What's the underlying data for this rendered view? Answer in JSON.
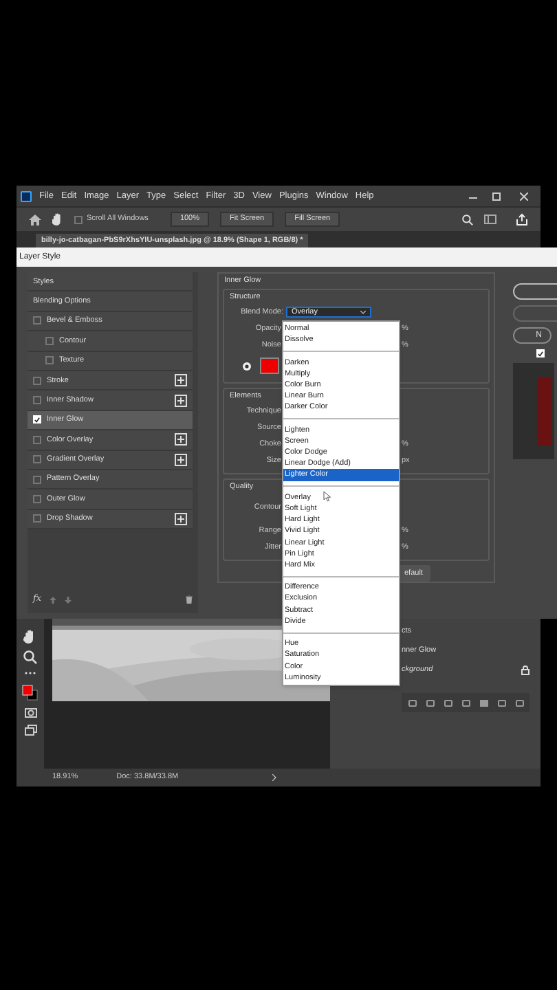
{
  "menu_bar": {
    "items": [
      "File",
      "Edit",
      "Image",
      "Layer",
      "Type",
      "Select",
      "Filter",
      "3D",
      "View",
      "Plugins",
      "Window",
      "Help"
    ]
  },
  "options_bar": {
    "scroll_all_windows": {
      "label": "Scroll All Windows",
      "checked": false
    },
    "zoom": "100%",
    "buttons": [
      "Fit Screen",
      "Fill Screen"
    ]
  },
  "document_tab": {
    "title": "billy-jo-catbagan-PbS9rXhsYIU-unsplash.jpg @ 18.9% (Shape 1, RGB/8) *"
  },
  "dialog": {
    "title": "Layer Style",
    "styles_list": [
      {
        "kind": "header",
        "label": "Styles",
        "selected": false
      },
      {
        "kind": "header",
        "label": "Blending Options",
        "selected": false
      },
      {
        "kind": "effect",
        "label": "Bevel & Emboss",
        "checked": false,
        "selected": false,
        "add_button": false,
        "children": [
          {
            "kind": "effect",
            "label": "Contour",
            "checked": false,
            "selected": false,
            "add_button": false
          },
          {
            "kind": "effect",
            "label": "Texture",
            "checked": false,
            "selected": false,
            "add_button": false
          }
        ]
      },
      {
        "kind": "effect",
        "label": "Stroke",
        "checked": false,
        "selected": false,
        "add_button": true
      },
      {
        "kind": "effect",
        "label": "Inner Shadow",
        "checked": false,
        "selected": false,
        "add_button": true
      },
      {
        "kind": "effect",
        "label": "Inner Glow",
        "checked": true,
        "selected": true,
        "add_button": false
      },
      {
        "kind": "effect",
        "label": "Color Overlay",
        "checked": false,
        "selected": false,
        "add_button": true
      },
      {
        "kind": "effect",
        "label": "Gradient Overlay",
        "checked": false,
        "selected": false,
        "add_button": true
      },
      {
        "kind": "effect",
        "label": "Pattern Overlay",
        "checked": false,
        "selected": false,
        "add_button": false
      },
      {
        "kind": "effect",
        "label": "Outer Glow",
        "checked": false,
        "selected": false,
        "add_button": false
      },
      {
        "kind": "effect",
        "label": "Drop Shadow",
        "checked": false,
        "selected": false,
        "add_button": true
      }
    ],
    "panel_title": "Inner Glow",
    "structure": {
      "title": "Structure",
      "fields": [
        {
          "label": "Blend Mode:",
          "kind": "select",
          "value": "Overlay"
        },
        {
          "label": "Opacity:",
          "kind": "unit",
          "unit": "%"
        },
        {
          "label": "Noise:",
          "kind": "unit",
          "unit": "%"
        },
        {
          "kind": "color",
          "checked": true
        }
      ]
    },
    "elements": {
      "title": "Elements",
      "fields": [
        {
          "label": "Technique:",
          "kind": "plain"
        },
        {
          "label": "Source:",
          "kind": "plain"
        },
        {
          "label": "Choke:",
          "kind": "unit",
          "unit": "%"
        },
        {
          "label": "Size:",
          "kind": "unit",
          "unit": "px"
        }
      ]
    },
    "quality": {
      "title": "Quality",
      "fields": [
        {
          "label": "Contour:",
          "kind": "tall"
        },
        {
          "label": "Range:",
          "kind": "unit",
          "unit": "%"
        },
        {
          "label": "Jitter:",
          "kind": "unit",
          "unit": "%"
        }
      ]
    },
    "default_button": "efault",
    "fx_label": "fx",
    "side_button_label": "N",
    "preview_checkbox": {
      "checked": true
    },
    "blend_mode_menu": {
      "groups": [
        [
          {
            "label": "Normal",
            "selected": false
          },
          {
            "label": "Dissolve",
            "selected": false
          }
        ],
        [
          {
            "label": "Darken",
            "selected": false
          },
          {
            "label": "Multiply",
            "selected": false
          },
          {
            "label": "Color Burn",
            "selected": false
          },
          {
            "label": "Linear Burn",
            "selected": false
          },
          {
            "label": "Darker Color",
            "selected": false
          }
        ],
        [
          {
            "label": "Lighten",
            "selected": false
          },
          {
            "label": "Screen",
            "selected": false
          },
          {
            "label": "Color Dodge",
            "selected": false
          },
          {
            "label": "Linear Dodge (Add)",
            "selected": false
          },
          {
            "label": "Lighter Color",
            "selected": true
          }
        ],
        [
          {
            "label": "Overlay",
            "selected": false
          },
          {
            "label": "Soft Light",
            "selected": false
          },
          {
            "label": "Hard Light",
            "selected": false
          },
          {
            "label": "Vivid Light",
            "selected": false
          },
          {
            "label": "Linear Light",
            "selected": false
          },
          {
            "label": "Pin Light",
            "selected": false
          },
          {
            "label": "Hard Mix",
            "selected": false
          }
        ],
        [
          {
            "label": "Difference",
            "selected": false
          },
          {
            "label": "Exclusion",
            "selected": false
          },
          {
            "label": "Subtract",
            "selected": false
          },
          {
            "label": "Divide",
            "selected": false
          }
        ],
        [
          {
            "label": "Hue",
            "selected": false
          },
          {
            "label": "Saturation",
            "selected": false
          },
          {
            "label": "Color",
            "selected": false
          },
          {
            "label": "Luminosity",
            "selected": false
          }
        ]
      ]
    }
  },
  "layers_panel": {
    "rows": [
      {
        "label": "cts",
        "kind": "plain"
      },
      {
        "label": "nner Glow",
        "kind": "plain"
      },
      {
        "label": "ckground",
        "kind": "locked"
      }
    ]
  },
  "status_bar": {
    "zoom": "18.91%",
    "doc": "Doc: 33.8M/33.8M"
  }
}
